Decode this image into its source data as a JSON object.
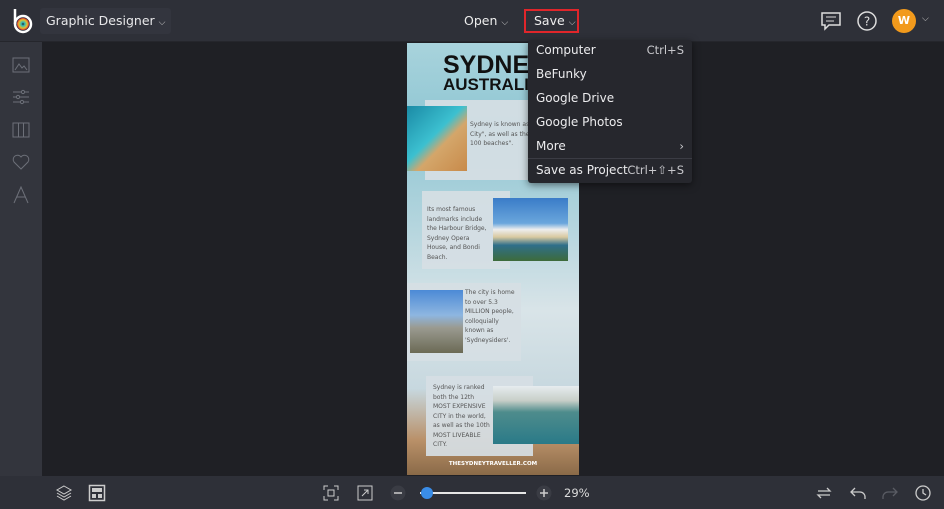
{
  "header": {
    "app_mode": "Graphic Designer",
    "open_label": "Open",
    "save_label": "Save",
    "avatar_initial": "W"
  },
  "save_menu": {
    "items": [
      {
        "label": "Computer",
        "shortcut": "Ctrl+S"
      },
      {
        "label": "BeFunky",
        "shortcut": ""
      },
      {
        "label": "Google Drive",
        "shortcut": ""
      },
      {
        "label": "Google Photos",
        "shortcut": ""
      },
      {
        "label": "More",
        "shortcut": "›"
      },
      {
        "label": "Save as Project",
        "shortcut": "Ctrl+⇧+S"
      }
    ]
  },
  "poster": {
    "title1": "SYDNEY",
    "title2": "AUSTRALIA",
    "block1": "Sydney is known as the \"Harbour City\", as well as the \"City of over 100 beaches\".",
    "block2": "Its most famous landmarks include the Harbour Bridge, Sydney Opera House, and Bondi Beach.",
    "block3": "The city is home to over 5.3 MILLION people, colloquially known as 'Sydneysiders'.",
    "block4": "Sydney is ranked both the 12th MOST EXPENSIVE CITY in the world, as well as the 10th MOST LIVEABLE CITY.",
    "footer": "THESYDNEYTRAVELLER.COM"
  },
  "bottom": {
    "zoom": "29%",
    "zoom_value": 29
  },
  "colors": {
    "accent": "#3a8de8",
    "highlight": "#e0262b",
    "avatar": "#f29a1c"
  }
}
